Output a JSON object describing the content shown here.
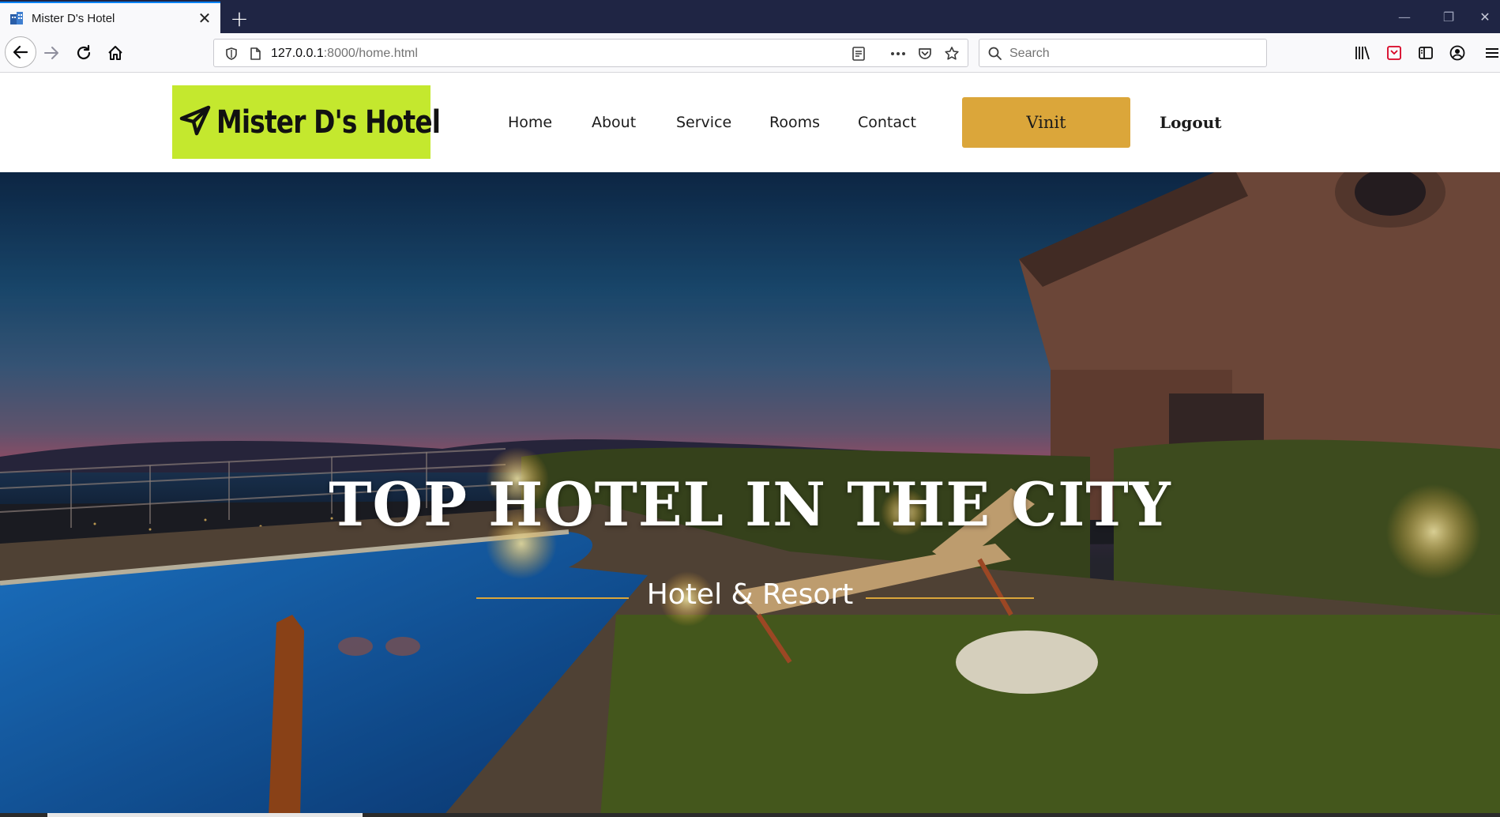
{
  "browser": {
    "tab_title": "Mister D's Hotel",
    "url_host": "127.0.0.1",
    "url_rest": ":8000/home.html",
    "search_placeholder": "Search"
  },
  "site": {
    "logo_text": "Mister D's Hotel",
    "menu": [
      "Home",
      "About",
      "Service",
      "Rooms",
      "Contact"
    ],
    "cta_label": "Vinit",
    "logout_label": "Logout",
    "accent_color": "#dba63a",
    "logo_bg_color": "#c4e82e"
  },
  "hero": {
    "title": "TOP HOTEL IN THE CITY",
    "subtitle": "Hotel & Resort",
    "slider_progress": 0.21
  }
}
